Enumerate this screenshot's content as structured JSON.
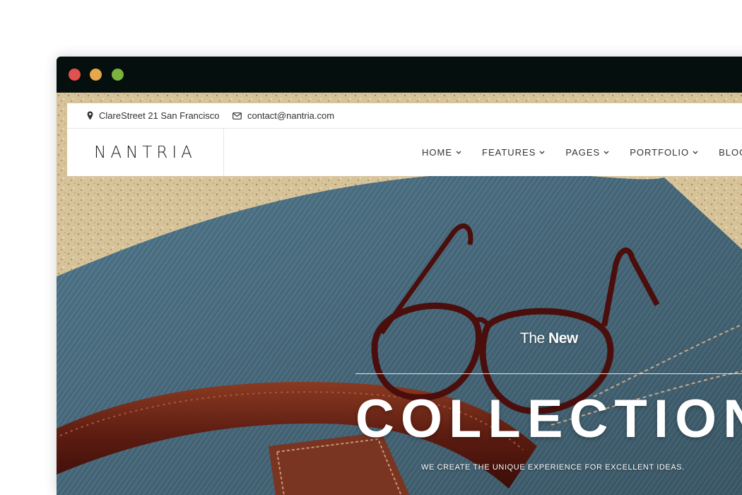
{
  "window": {
    "controls": [
      "close",
      "minimize",
      "maximize"
    ],
    "colors": {
      "close": "#e0514f",
      "minimize": "#e5a84b",
      "maximize": "#7ab43c",
      "titlebar": "#050f0e"
    }
  },
  "topbar": {
    "address": {
      "icon": "map-pin-icon",
      "text": "ClareStreet 21 San Francisco"
    },
    "email": {
      "icon": "envelope-icon",
      "text": "contact@nantria.com"
    }
  },
  "nav": {
    "logo": "NANTRIA",
    "items": [
      {
        "label": "HOME",
        "icon": "chevron-down-icon"
      },
      {
        "label": "FEATURES",
        "icon": "chevron-down-icon"
      },
      {
        "label": "PAGES",
        "icon": "chevron-down-icon"
      },
      {
        "label": "PORTFOLIO",
        "icon": "chevron-down-icon"
      },
      {
        "label": "BLOG",
        "icon": "chevron-down-icon"
      }
    ]
  },
  "hero": {
    "eyebrow_light": "The",
    "eyebrow_bold": "New",
    "title": "COLLECTION",
    "subtitle": "WE CREATE THE UNIQUE EXPERIENCE FOR EXCELLENT IDEAS.",
    "image": "photo of sunglasses and a leather belt on denim fabric lying on sand"
  }
}
